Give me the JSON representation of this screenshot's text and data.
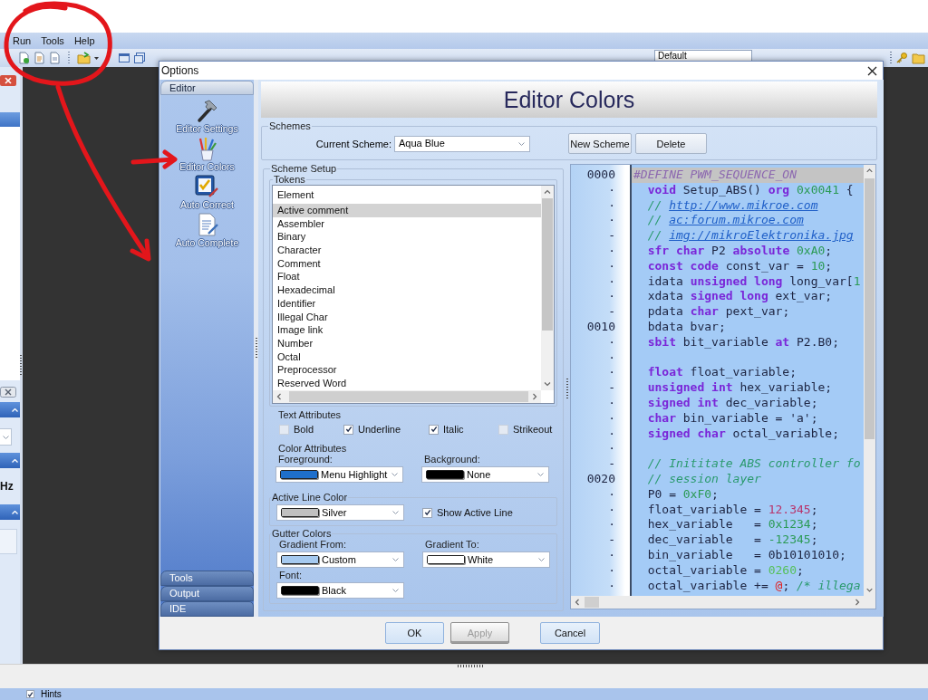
{
  "menu_bar": {
    "items": [
      "Run",
      "Tools",
      "Help"
    ]
  },
  "toolbar": {
    "style_combo": "Default"
  },
  "side_panel": {
    "label": "Hz"
  },
  "dialog": {
    "title": "Options",
    "categories": [
      {
        "label": "Editor",
        "expanded": true,
        "items": [
          {
            "label": "Editor Settings"
          },
          {
            "label": "Editor Colors"
          },
          {
            "label": "Auto Correct"
          },
          {
            "label": "Auto Complete"
          }
        ]
      },
      {
        "label": "Tools",
        "expanded": false
      },
      {
        "label": "Output",
        "expanded": false
      },
      {
        "label": "IDE",
        "expanded": false
      }
    ],
    "page_title": "Editor Colors",
    "schemes": {
      "legend": "Schemes",
      "current_label": "Current Scheme:",
      "current": "Aqua Blue",
      "buttons": [
        "New Scheme",
        "Delete"
      ]
    },
    "scheme_setup": {
      "legend": "Scheme Setup",
      "tokens": {
        "legend": "Tokens",
        "header": "Element",
        "items": [
          {
            "label": "Active comment",
            "selected": true
          },
          {
            "label": "Assembler",
            "selected": false
          },
          {
            "label": "Binary",
            "selected": false
          },
          {
            "label": "Character",
            "selected": false
          },
          {
            "label": "Comment",
            "selected": false
          },
          {
            "label": "Float",
            "selected": false
          },
          {
            "label": "Hexadecimal",
            "selected": false
          },
          {
            "label": "Identifier",
            "selected": false
          },
          {
            "label": "Illegal Char",
            "selected": false
          },
          {
            "label": "Image link",
            "selected": false
          },
          {
            "label": "Number",
            "selected": false
          },
          {
            "label": "Octal",
            "selected": false
          },
          {
            "label": "Preprocessor",
            "selected": false
          },
          {
            "label": "Reserved Word",
            "selected": false
          }
        ]
      },
      "text_attributes": {
        "legend": "Text Attributes",
        "options": [
          {
            "label": "Bold",
            "checked": false
          },
          {
            "label": "Underline",
            "checked": true
          },
          {
            "label": "Italic",
            "checked": true
          },
          {
            "label": "Strikeout",
            "checked": false
          }
        ]
      },
      "color_attributes": {
        "legend": "Color Attributes",
        "pickers": [
          {
            "label": "Foreground:",
            "value": "Menu Highlight",
            "color": "#1e6fcb"
          },
          {
            "label": "Background:",
            "value": "None",
            "color": "#000000"
          }
        ]
      },
      "active_line": {
        "legend": "Active Line Color",
        "picker": {
          "value": "Silver",
          "color": "#c0c0c0"
        },
        "show_active_line": {
          "label": "Show Active Line",
          "checked": true
        }
      },
      "gutter_colors": {
        "legend": "Gutter Colors",
        "pickers": [
          {
            "label": "Gradient From:",
            "value": "Custom",
            "color": "#a6caf0"
          },
          {
            "label": "Gradient To:",
            "value": "White",
            "color": "#ffffff"
          },
          {
            "label": "Font:",
            "value": "Black",
            "color": "#000000"
          }
        ]
      }
    },
    "preview": {
      "lines": [
        {
          "gutter": "0000",
          "active": true,
          "segments": [
            {
              "kind": "directive",
              "text": "#DEFINE PWM_SEQUENCE_ON"
            }
          ]
        },
        {
          "gutter": "·",
          "active": false,
          "segments": [
            {
              "kind": "keyword",
              "text": "  void"
            },
            {
              "kind": "plain",
              "text": " Setup_ABS() "
            },
            {
              "kind": "keyword",
              "text": "org"
            },
            {
              "kind": "number",
              "text": " 0x0041"
            },
            {
              "kind": "plain",
              "text": " {"
            }
          ]
        },
        {
          "gutter": "·",
          "active": false,
          "segments": [
            {
              "kind": "comment",
              "text": "  // "
            },
            {
              "kind": "link",
              "text": "http://www.mikroe.com"
            }
          ]
        },
        {
          "gutter": "·",
          "active": false,
          "segments": [
            {
              "kind": "comment",
              "text": "  // "
            },
            {
              "kind": "link",
              "text": "ac:forum.mikroe.com"
            }
          ]
        },
        {
          "gutter": "-",
          "active": false,
          "segments": [
            {
              "kind": "comment",
              "text": "  // "
            },
            {
              "kind": "link",
              "text": "img://mikroElektronika.jpg"
            }
          ]
        },
        {
          "gutter": "·",
          "active": false,
          "segments": [
            {
              "kind": "keyword",
              "text": "  sfr char"
            },
            {
              "kind": "plain",
              "text": " P2 "
            },
            {
              "kind": "keyword",
              "text": "absolute"
            },
            {
              "kind": "number",
              "text": " 0xA0"
            },
            {
              "kind": "plain",
              "text": ";"
            }
          ]
        },
        {
          "gutter": "·",
          "active": false,
          "segments": [
            {
              "kind": "keyword",
              "text": "  const code"
            },
            {
              "kind": "plain",
              "text": " const_var = "
            },
            {
              "kind": "number",
              "text": "10"
            },
            {
              "kind": "plain",
              "text": ";"
            }
          ]
        },
        {
          "gutter": "·",
          "active": false,
          "segments": [
            {
              "kind": "plain",
              "text": "  idata "
            },
            {
              "kind": "keyword",
              "text": "unsigned long"
            },
            {
              "kind": "plain",
              "text": " long_var["
            },
            {
              "kind": "number",
              "text": "1"
            }
          ]
        },
        {
          "gutter": "·",
          "active": false,
          "segments": [
            {
              "kind": "plain",
              "text": "  xdata "
            },
            {
              "kind": "keyword",
              "text": "signed long"
            },
            {
              "kind": "plain",
              "text": " ext_var;"
            }
          ]
        },
        {
          "gutter": "-",
          "active": false,
          "segments": [
            {
              "kind": "plain",
              "text": "  pdata "
            },
            {
              "kind": "keyword",
              "text": "char"
            },
            {
              "kind": "plain",
              "text": " pext_var;"
            }
          ]
        },
        {
          "gutter": "0010",
          "active": false,
          "segments": [
            {
              "kind": "plain",
              "text": "  bdata bvar;"
            }
          ]
        },
        {
          "gutter": "·",
          "active": false,
          "segments": [
            {
              "kind": "keyword",
              "text": "  sbit"
            },
            {
              "kind": "plain",
              "text": " bit_variable "
            },
            {
              "kind": "keyword",
              "text": "at"
            },
            {
              "kind": "plain",
              "text": " P2.B0;"
            }
          ]
        },
        {
          "gutter": "·",
          "active": false
        },
        {
          "gutter": "·",
          "active": false,
          "segments": [
            {
              "kind": "keyword",
              "text": "  float"
            },
            {
              "kind": "plain",
              "text": " float_variable;"
            }
          ]
        },
        {
          "gutter": "-",
          "active": false,
          "segments": [
            {
              "kind": "keyword",
              "text": "  unsigned int"
            },
            {
              "kind": "plain",
              "text": " hex_variable;"
            }
          ]
        },
        {
          "gutter": "·",
          "active": false,
          "segments": [
            {
              "kind": "keyword",
              "text": "  signed int"
            },
            {
              "kind": "plain",
              "text": " dec_variable;"
            }
          ]
        },
        {
          "gutter": "·",
          "active": false,
          "segments": [
            {
              "kind": "keyword",
              "text": "  char"
            },
            {
              "kind": "plain",
              "text": " bin_variable = 'a';"
            }
          ]
        },
        {
          "gutter": "·",
          "active": false,
          "segments": [
            {
              "kind": "keyword",
              "text": "  signed char"
            },
            {
              "kind": "plain",
              "text": " octal_variable;"
            }
          ]
        },
        {
          "gutter": "·",
          "active": false
        },
        {
          "gutter": "-",
          "active": false,
          "segments": [
            {
              "kind": "comment",
              "text": "  // Inititate ABS controller fo"
            }
          ]
        },
        {
          "gutter": "0020",
          "active": false,
          "segments": [
            {
              "kind": "comment",
              "text": "  // session layer"
            }
          ]
        },
        {
          "gutter": "·",
          "active": false,
          "segments": [
            {
              "kind": "plain",
              "text": "  P0 = "
            },
            {
              "kind": "number",
              "text": "0xF0"
            },
            {
              "kind": "plain",
              "text": ";"
            }
          ]
        },
        {
          "gutter": "·",
          "active": false,
          "segments": [
            {
              "kind": "plain",
              "text": "  float_variable = "
            },
            {
              "kind": "float",
              "text": "12.345"
            },
            {
              "kind": "plain",
              "text": ";"
            }
          ]
        },
        {
          "gutter": "·",
          "active": false,
          "segments": [
            {
              "kind": "plain",
              "text": "  hex_variable   = "
            },
            {
              "kind": "number",
              "text": "0x1234"
            },
            {
              "kind": "plain",
              "text": ";"
            }
          ]
        },
        {
          "gutter": "-",
          "active": false,
          "segments": [
            {
              "kind": "plain",
              "text": "  dec_variable   = "
            },
            {
              "kind": "number",
              "text": "-12345"
            },
            {
              "kind": "plain",
              "text": ";"
            }
          ]
        },
        {
          "gutter": "·",
          "active": false,
          "segments": [
            {
              "kind": "plain",
              "text": "  bin_variable   = 0b10101010;"
            }
          ]
        },
        {
          "gutter": "·",
          "active": false,
          "segments": [
            {
              "kind": "plain",
              "text": "  octal_variable = "
            },
            {
              "kind": "octal",
              "text": "0260"
            },
            {
              "kind": "plain",
              "text": ";"
            }
          ]
        },
        {
          "gutter": "·",
          "active": false,
          "segments": [
            {
              "kind": "plain",
              "text": "  octal_variable += "
            },
            {
              "kind": "illegal",
              "text": "@"
            },
            {
              "kind": "plain",
              "text": "; "
            },
            {
              "kind": "comment",
              "text": "/* illega"
            }
          ]
        }
      ]
    },
    "buttons": [
      {
        "label": "OK",
        "disabled": false
      },
      {
        "label": "Apply",
        "disabled": true
      },
      {
        "label": "Cancel",
        "disabled": false
      }
    ]
  },
  "status_bar": {
    "hints": {
      "label": "Hints",
      "checked": true
    }
  }
}
